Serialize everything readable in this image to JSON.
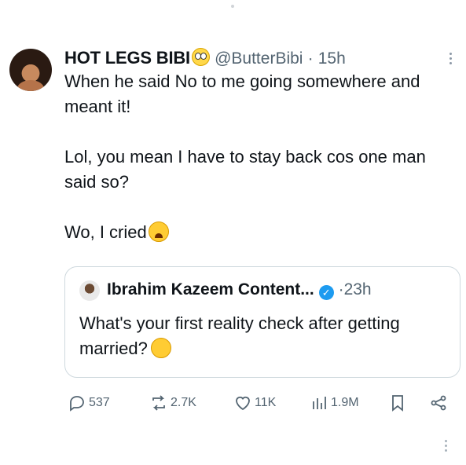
{
  "tweet": {
    "name": "HOT LEGS BIBI",
    "handle": "@ButterBibi",
    "separator": "·",
    "time": "15h",
    "paragraphs": [
      "When he said No to me going somewhere and meant it!",
      "Lol, you mean I have to stay back cos one man said so?",
      "Wo, I cried"
    ],
    "name_emoji": "rolling-eyes-face-icon",
    "end_emoji": "weary-face-icon"
  },
  "quote": {
    "name": "Ibrahim Kazeem Content...",
    "verified_icon": "verified-badge-icon",
    "separator": "·",
    "time": "23h",
    "text": "What's your first reality check after getting married?",
    "emoji": "thinking-face-icon"
  },
  "actions": {
    "replies": "537",
    "reposts": "2.7K",
    "likes": "11K",
    "views": "1.9M"
  },
  "colors": {
    "text": "#0f1419",
    "muted": "#536471",
    "border": "#cfd9de",
    "verified": "#1d9bf0"
  }
}
